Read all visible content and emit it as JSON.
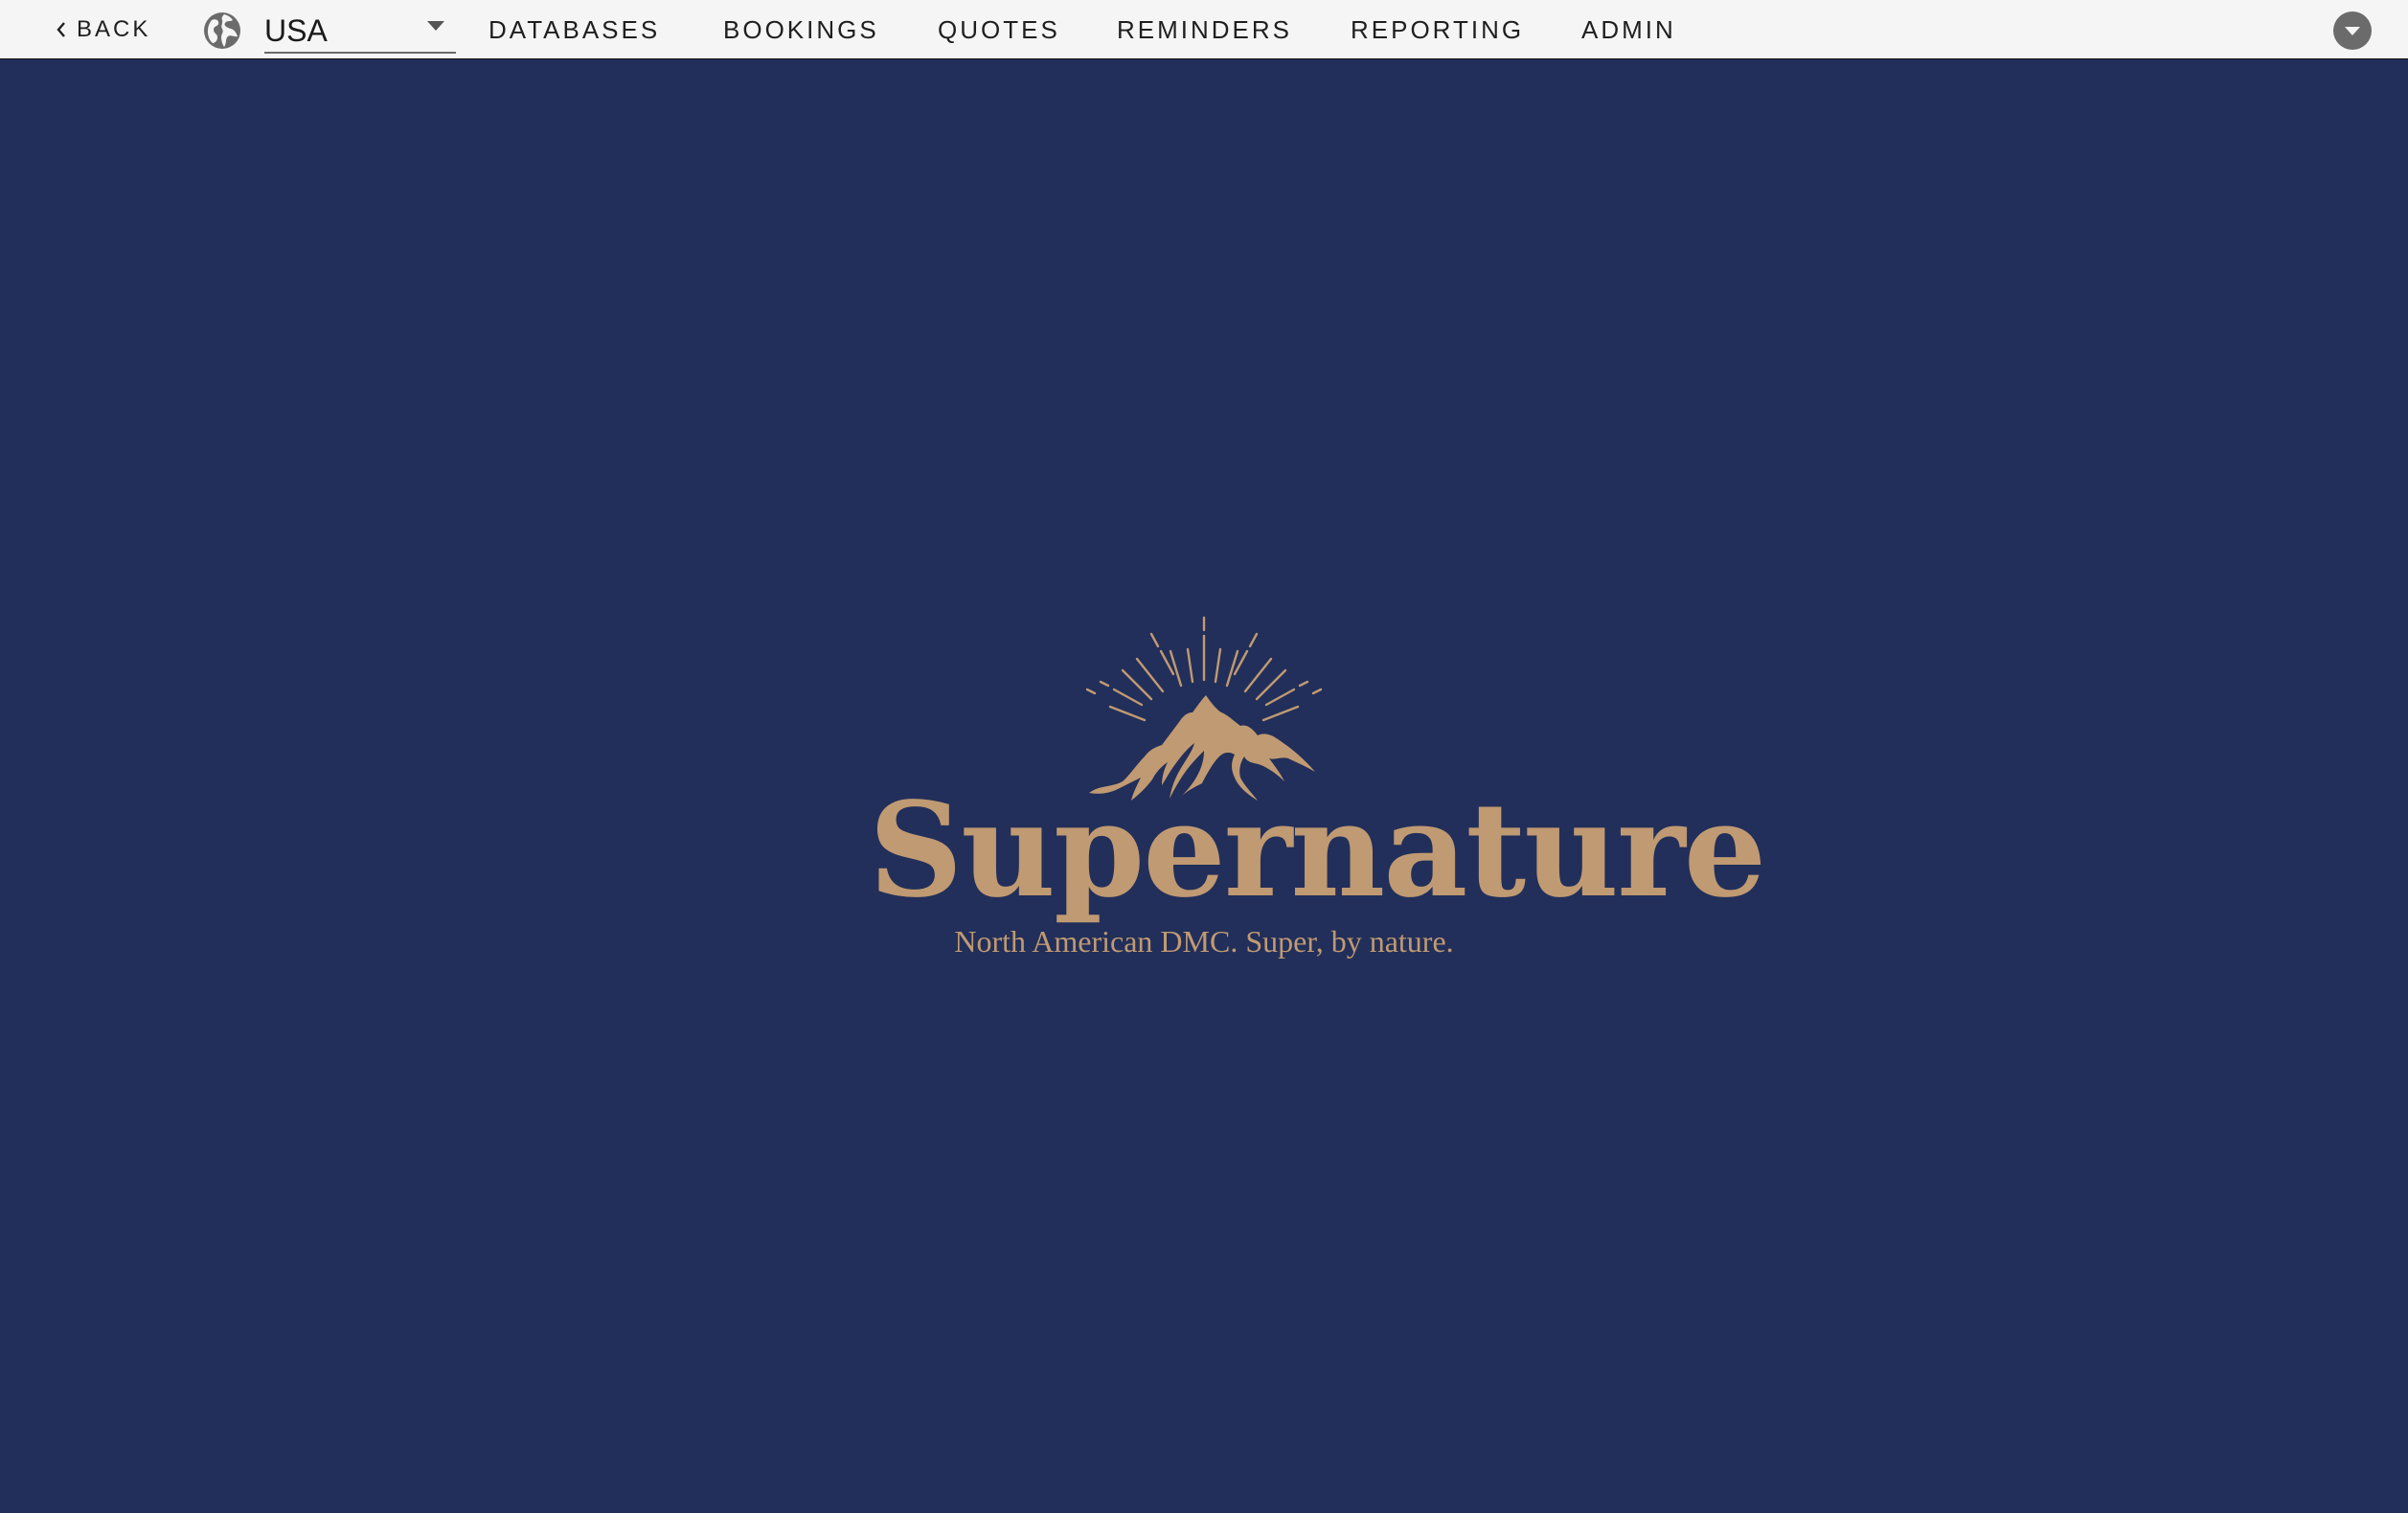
{
  "header": {
    "back_label": "BACK",
    "region": {
      "selected": "USA"
    },
    "nav": [
      {
        "label": "DATABASES"
      },
      {
        "label": "BOOKINGS"
      },
      {
        "label": "QUOTES"
      },
      {
        "label": "REMINDERS"
      },
      {
        "label": "REPORTING"
      },
      {
        "label": "ADMIN"
      }
    ],
    "icons": {
      "back": "chevron-left-icon",
      "region": "globe-icon",
      "user_menu": "chevron-down-icon"
    }
  },
  "main": {
    "logo": {
      "name": "Supernature",
      "tagline": "North American DMC. Super, by nature."
    }
  },
  "colors": {
    "background": "#222f5a",
    "topbar": "#f5f5f5",
    "brand_gold": "#c09a72",
    "icon_gray": "#6b6b6b"
  }
}
